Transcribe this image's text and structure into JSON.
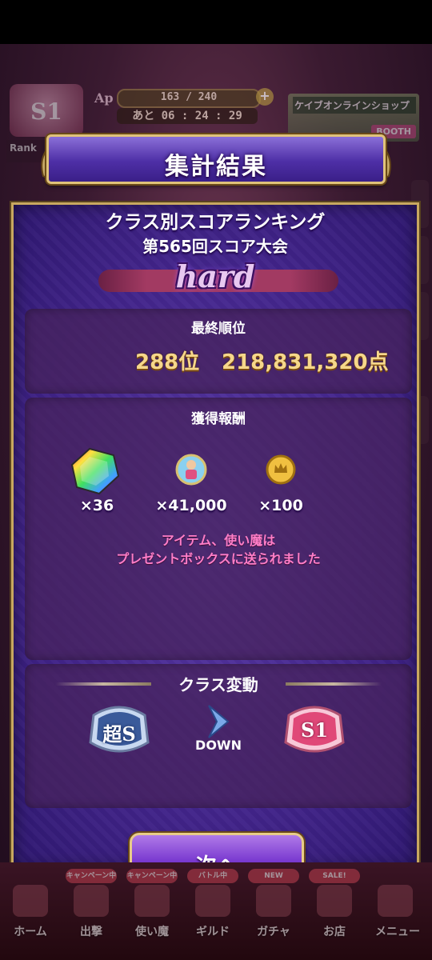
{
  "hud": {
    "class_label": "S1",
    "rank_label": "Rank",
    "ap_label": "Ap",
    "ap_value": "163 / 240",
    "ap_timer": "あと 06 : 24 : 29",
    "shop_label": "ケイブオンラインショップ",
    "shop_sub": "BOOTH"
  },
  "dialog": {
    "title": "集計結果",
    "subtitle": "クラス別スコアランキング",
    "tournament": "第565回スコア大会",
    "difficulty": "hard",
    "final_rank_label": "最終順位",
    "rank_position": "288位",
    "score": "218,831,320点",
    "rewards_label": "獲得報酬",
    "rewards": [
      {
        "icon": "rainbow-gem-icon",
        "count": "×36"
      },
      {
        "icon": "familiar-medal-icon",
        "count": "×41,000"
      },
      {
        "icon": "gold-coin-icon",
        "count": "×100"
      }
    ],
    "notice_line1": "アイテム、使い魔は",
    "notice_line2": "プレゼントボックスに送られました",
    "class_change_label": "クラス変動",
    "from_class": "超S",
    "to_class": "S1",
    "direction": "DOWN",
    "next_button": "次へ"
  },
  "nav": [
    {
      "label": "ホーム",
      "tag": ""
    },
    {
      "label": "出撃",
      "tag": "キャンペーン中"
    },
    {
      "label": "使い魔",
      "tag": "キャンペーン中"
    },
    {
      "label": "ギルド",
      "tag": "バトル中"
    },
    {
      "label": "ガチャ",
      "tag": "NEW"
    },
    {
      "label": "お店",
      "tag": "SALE!"
    },
    {
      "label": "メニュー",
      "tag": ""
    }
  ],
  "colors": {
    "accent_gold": "#c8a860",
    "window_purple": "#42248a",
    "notice_pink": "#ff7ec8",
    "score_gold": "#f6d78a"
  }
}
